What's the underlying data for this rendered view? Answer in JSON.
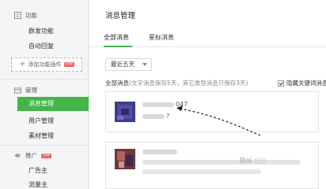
{
  "sidebar": {
    "function_section": {
      "title": "功能",
      "icon": "function-icon"
    },
    "function_items": [
      {
        "label": "群发功能"
      },
      {
        "label": "自动回复"
      }
    ],
    "add_plugin": {
      "label": "添加功能插件",
      "badge": "new"
    },
    "manage_section": {
      "title": "管理",
      "icon": "manage-icon"
    },
    "manage_items": [
      {
        "label": "消息管理",
        "active": true
      },
      {
        "label": "用户管理"
      },
      {
        "label": "素材管理"
      }
    ],
    "promote_section": {
      "title": "推广",
      "icon": "megaphone-icon",
      "badge": "new"
    },
    "promote_items": [
      {
        "label": "广告主"
      },
      {
        "label": "流量主"
      }
    ]
  },
  "main": {
    "title": "消息管理",
    "tabs": [
      {
        "label": "全部消息",
        "active": true
      },
      {
        "label": "星标消息"
      }
    ],
    "filter": {
      "selected": "最近五天"
    },
    "summary": {
      "label": "全部消息",
      "note": "(文字消息保存5天，其它类型消息只保存3天)"
    },
    "hide_keyword": {
      "label": "隐藏关键词消息",
      "checked": true
    },
    "messages": [
      {
        "sender_visible": "047",
        "text_visible": "?"
      },
      {
        "sender_visible": "",
        "text_visible": ""
      }
    ]
  },
  "watermark": {
    "text": "Bai",
    "sub": "经验"
  },
  "colors": {
    "accent": "#44b549",
    "badge": "#e66666"
  }
}
